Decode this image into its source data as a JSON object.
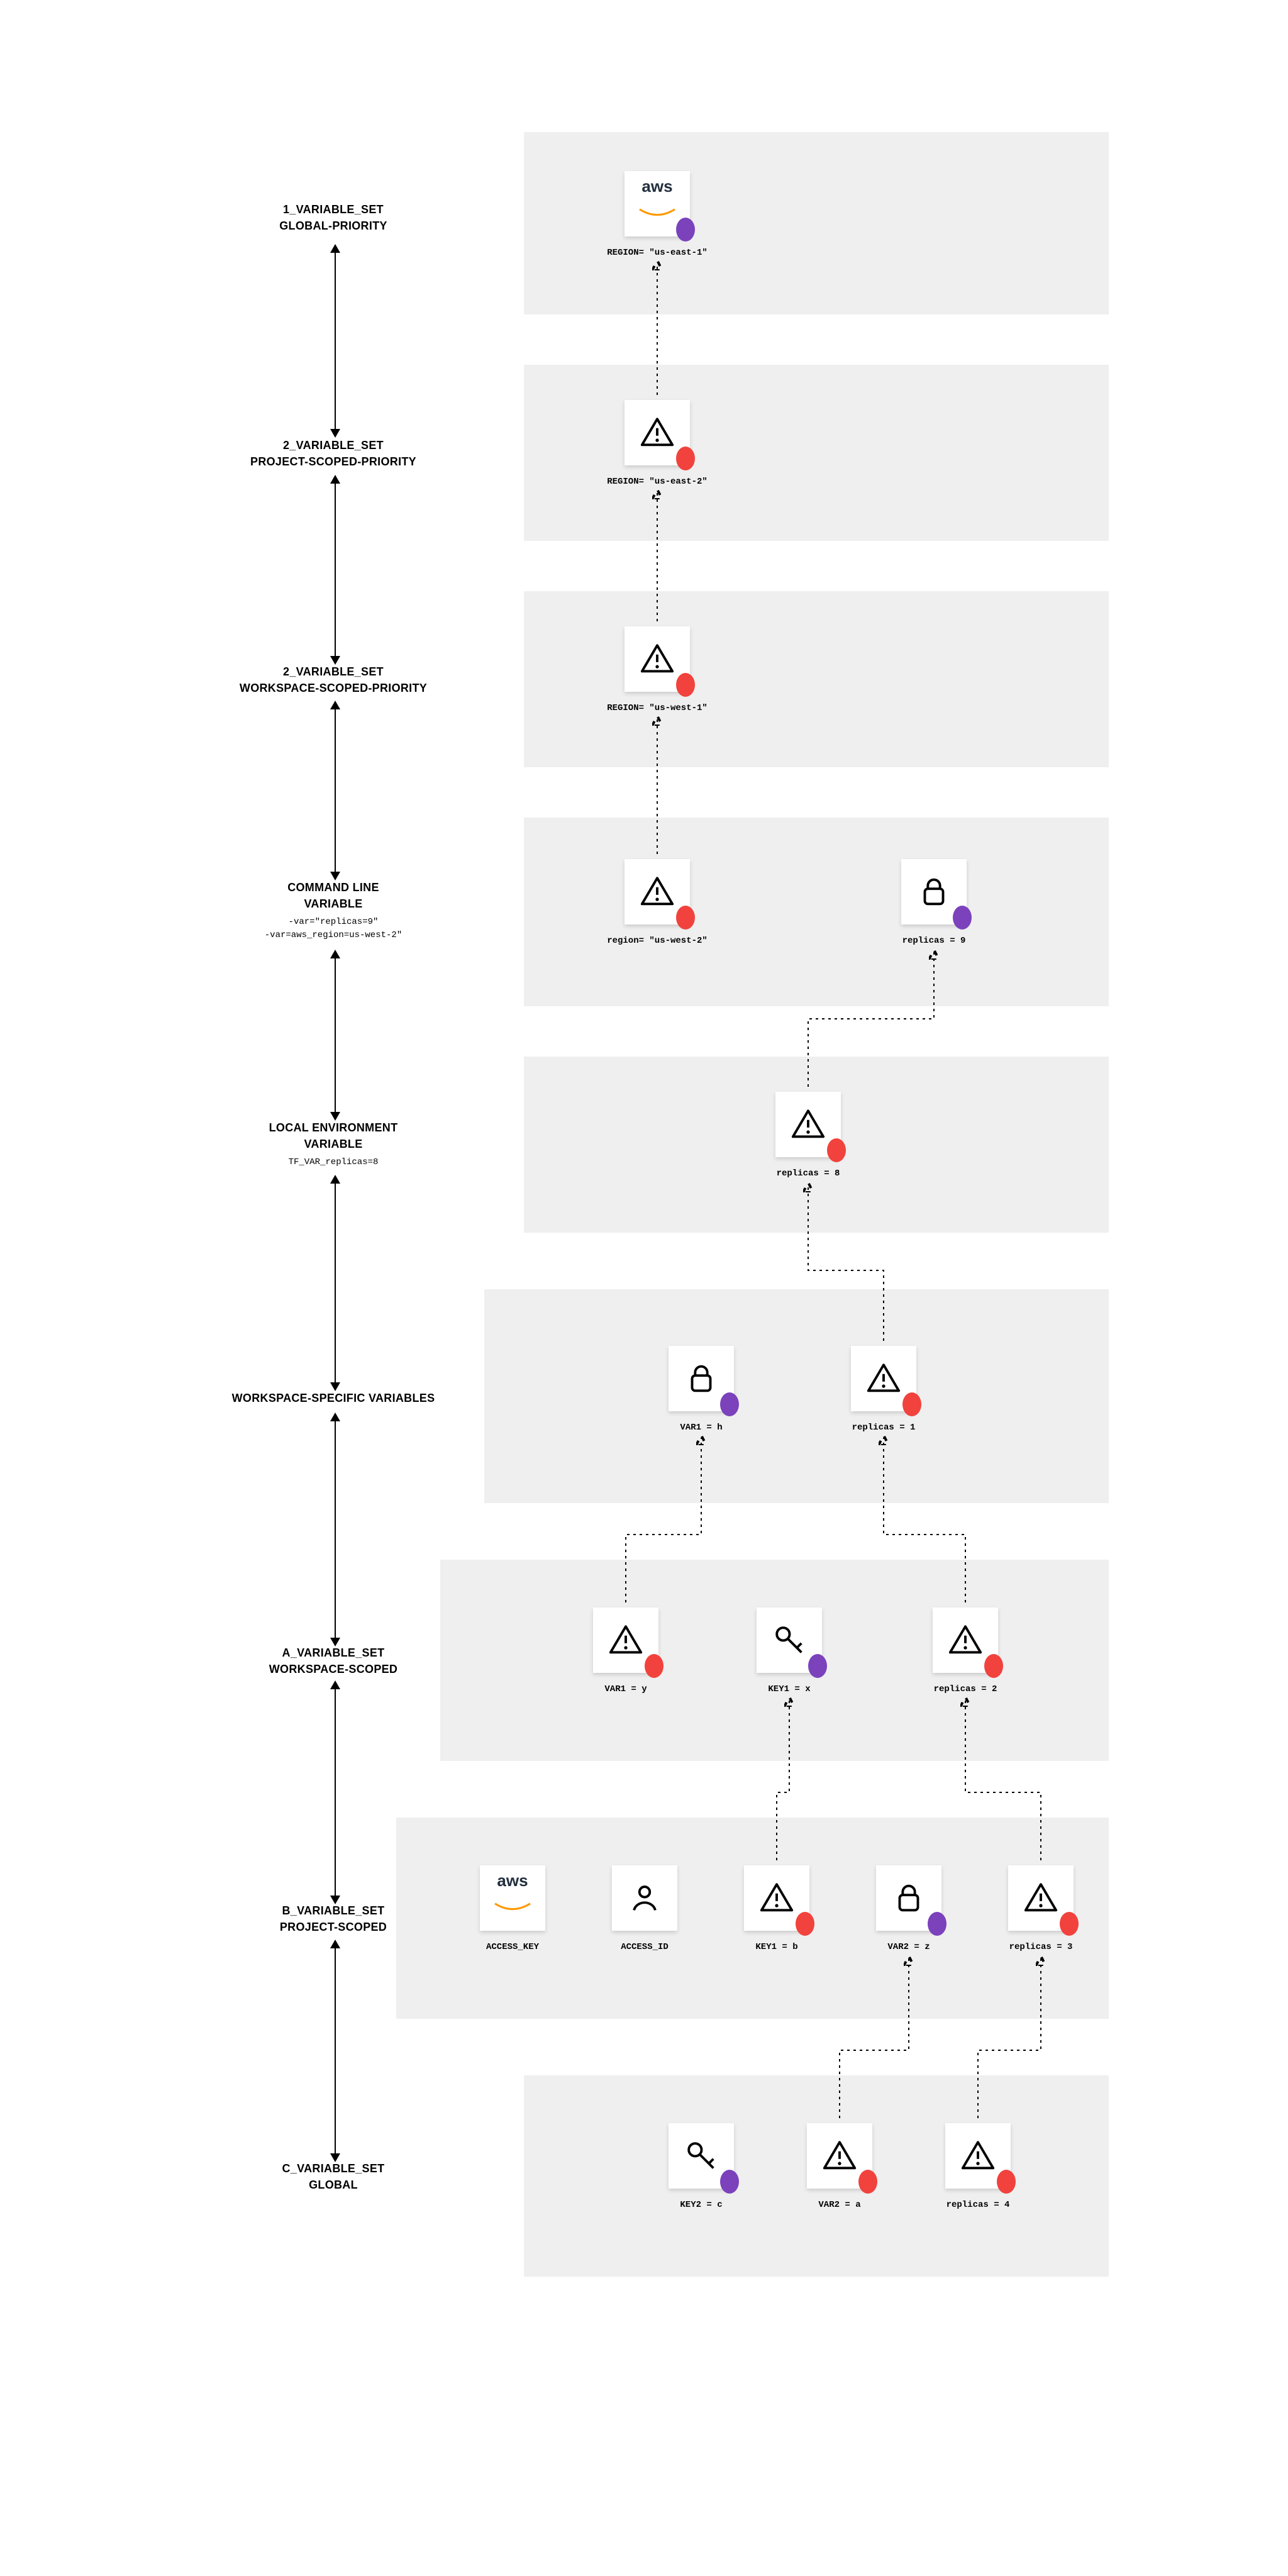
{
  "rows": {
    "r1": {
      "title": "1_VARIABLE_SET",
      "sub": "GLOBAL-PRIORITY"
    },
    "r2": {
      "title": "2_VARIABLE_SET",
      "sub": "PROJECT-SCOPED-PRIORITY"
    },
    "r3": {
      "title": "2_VARIABLE_SET",
      "sub": "WORKSPACE-SCOPED-PRIORITY"
    },
    "r4": {
      "title": "COMMAND LINE\nVARIABLE",
      "code": "-var=\"replicas=9\"\n-var=aws_region=us-west-2\""
    },
    "r5": {
      "title": "LOCAL ENVIRONMENT\nVARIABLE",
      "code": "TF_VAR_replicas=8"
    },
    "r6": {
      "title": "WORKSPACE-SPECIFIC VARIABLES"
    },
    "r7": {
      "title": "A_VARIABLE_SET",
      "sub": "WORKSPACE-SCOPED"
    },
    "r8": {
      "title": "B_VARIABLE_SET",
      "sub": "PROJECT-SCOPED"
    },
    "r9": {
      "title": "C_VARIABLE_SET",
      "sub": "GLOBAL"
    }
  },
  "cards": {
    "c1": {
      "icon": "aws",
      "dot": "purple",
      "label": "REGION= \"us-east-1\""
    },
    "c2": {
      "icon": "warn",
      "dot": "red",
      "label": "REGION= \"us-east-2\""
    },
    "c3": {
      "icon": "warn",
      "dot": "red",
      "label": "REGION= \"us-west-1\""
    },
    "c4a": {
      "icon": "warn",
      "dot": "red",
      "label": "region= \"us-west-2\""
    },
    "c4b": {
      "icon": "lock",
      "dot": "purple",
      "label": "replicas = 9"
    },
    "c5": {
      "icon": "warn",
      "dot": "red",
      "label": "replicas = 8"
    },
    "c6a": {
      "icon": "lock",
      "dot": "purple",
      "label": "VAR1 = h"
    },
    "c6b": {
      "icon": "warn",
      "dot": "red",
      "label": "replicas = 1"
    },
    "c7a": {
      "icon": "warn",
      "dot": "red",
      "label": "VAR1 = y"
    },
    "c7b": {
      "icon": "key",
      "dot": "purple",
      "label": "KEY1 = x"
    },
    "c7c": {
      "icon": "warn",
      "dot": "red",
      "label": "replicas = 2"
    },
    "c8a": {
      "icon": "aws",
      "dot": null,
      "label": "ACCESS_KEY"
    },
    "c8b": {
      "icon": "person",
      "dot": null,
      "label": "ACCESS_ID"
    },
    "c8c": {
      "icon": "warn",
      "dot": "red",
      "label": "KEY1 = b"
    },
    "c8d": {
      "icon": "lock",
      "dot": "purple",
      "label": "VAR2 = z"
    },
    "c8e": {
      "icon": "warn",
      "dot": "red",
      "label": "replicas = 3"
    },
    "c9a": {
      "icon": "key",
      "dot": "purple",
      "label": "KEY2 = c"
    },
    "c9b": {
      "icon": "warn",
      "dot": "red",
      "label": "VAR2 = a"
    },
    "c9c": {
      "icon": "warn",
      "dot": "red",
      "label": "replicas = 4"
    }
  }
}
